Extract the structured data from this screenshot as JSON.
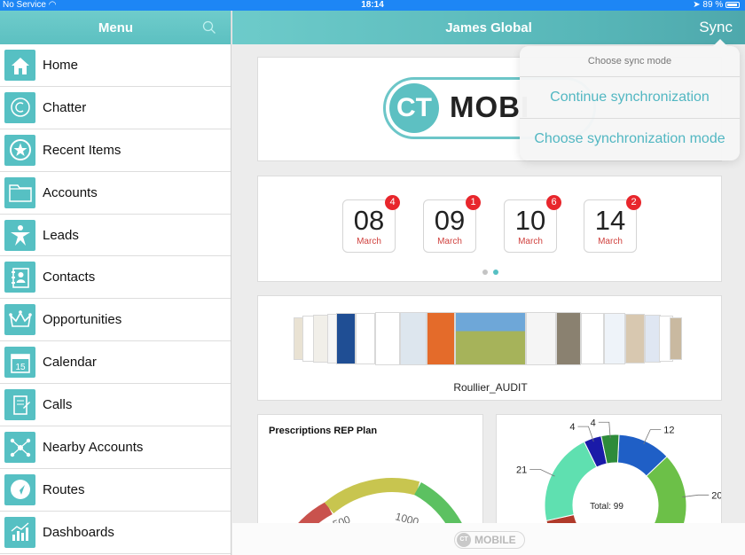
{
  "status_bar": {
    "carrier": "No Service",
    "time": "18:14",
    "battery": "89 %"
  },
  "sidebar": {
    "title": "Menu",
    "items": [
      {
        "label": "Home",
        "icon": "home-icon"
      },
      {
        "label": "Chatter",
        "icon": "chatter-icon"
      },
      {
        "label": "Recent Items",
        "icon": "star-icon"
      },
      {
        "label": "Accounts",
        "icon": "folder-icon"
      },
      {
        "label": "Leads",
        "icon": "person-star-icon"
      },
      {
        "label": "Contacts",
        "icon": "contact-book-icon"
      },
      {
        "label": "Opportunities",
        "icon": "crown-icon"
      },
      {
        "label": "Calendar",
        "icon": "calendar-icon",
        "icon_text": "15"
      },
      {
        "label": "Calls",
        "icon": "calls-icon"
      },
      {
        "label": "Nearby Accounts",
        "icon": "network-icon"
      },
      {
        "label": "Routes",
        "icon": "navigation-icon"
      },
      {
        "label": "Dashboards",
        "icon": "dashboard-icon"
      }
    ]
  },
  "header": {
    "title": "James Global",
    "sync_label": "Sync"
  },
  "logo": {
    "badge": "CT",
    "word": "MOBI"
  },
  "dates": [
    {
      "day": "08",
      "month": "March",
      "count": "4"
    },
    {
      "day": "09",
      "month": "March",
      "count": "1"
    },
    {
      "day": "10",
      "month": "March",
      "count": "6"
    },
    {
      "day": "14",
      "month": "March",
      "count": "2"
    }
  ],
  "gallery": {
    "caption": "Roullier_AUDIT"
  },
  "prescriptions": {
    "title": "Prescriptions REP Plan",
    "tick_labels": [
      "500",
      "1000"
    ]
  },
  "donut": {
    "total_label": "Total: 99",
    "segments": [
      {
        "value": 12,
        "label": "12",
        "color": "#1f5fc6"
      },
      {
        "value": 20,
        "label": "20",
        "color": "#6cc048"
      },
      {
        "value": 38,
        "label": "",
        "color": "#b03a2a"
      },
      {
        "value": 21,
        "label": "21",
        "color": "#5fe0b0"
      },
      {
        "value": 4,
        "label": "4",
        "color": "#1a1aa8"
      },
      {
        "value": 4,
        "label": "4",
        "color": "#2e8b3a"
      }
    ]
  },
  "sync_popover": {
    "title": "Choose sync mode",
    "option_continue": "Continue synchronization",
    "option_choose": "Choose synchronization mode"
  },
  "footer": {
    "badge": "CT",
    "word": "MOBILE"
  },
  "colors": {
    "accent": "#5cc0c1",
    "badge_red": "#e8262c",
    "month_red": "#d0423f",
    "status_blue": "#1d86f5"
  }
}
